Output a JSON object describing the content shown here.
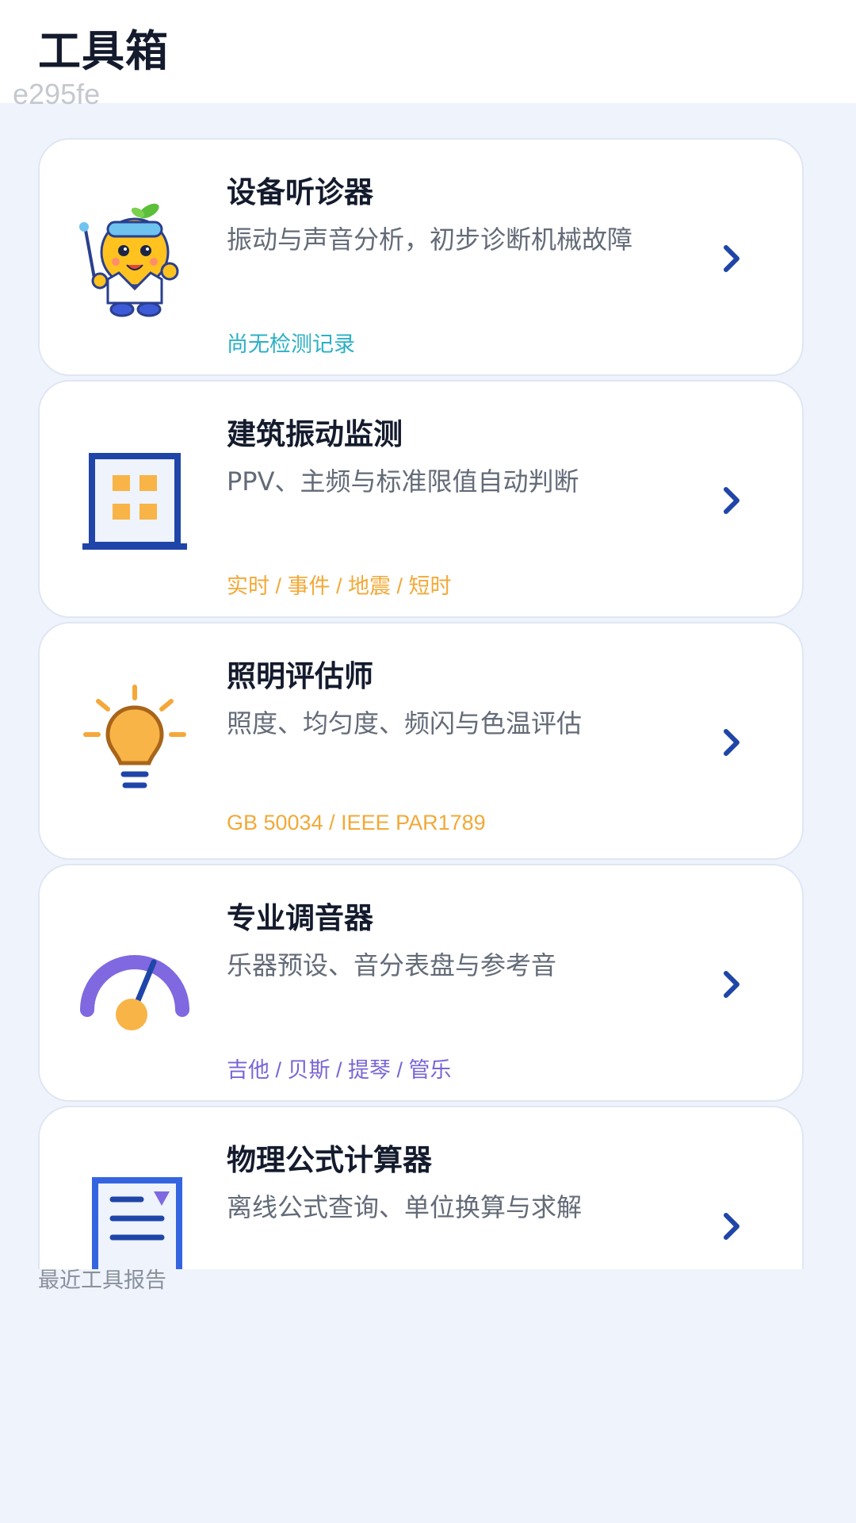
{
  "header": {
    "title": "工具箱",
    "hash_tag": "e295fe"
  },
  "tools": [
    {
      "title": "设备听诊器",
      "desc": "振动与声音分析，初步诊断机械故障",
      "tag": "尚无检测记录",
      "icon": "mascot-icon"
    },
    {
      "title": "建筑振动监测",
      "desc": "PPV、主频与标准限值自动判断",
      "tag": "实时 / 事件 / 地震 / 短时",
      "icon": "building-icon"
    },
    {
      "title": "照明评估师",
      "desc": "照度、均匀度、频闪与色温评估",
      "tag": "GB 50034 / IEEE PAR1789",
      "icon": "lightbulb-icon"
    },
    {
      "title": "专业调音器",
      "desc": "乐器预设、音分表盘与参考音",
      "tag": "吉他 / 贝斯 / 提琴 / 管乐",
      "icon": "gauge-icon"
    },
    {
      "title": "物理公式计算器",
      "desc": "离线公式查询、单位换算与求解",
      "tag": "",
      "icon": "formula-doc-icon"
    }
  ],
  "section_label": "最近工具报告",
  "colors": {
    "accent_blue": "#1f45a8",
    "tag_teal": "#2bb0c4",
    "tag_orange": "#f2a938",
    "tag_purple": "#7a65d6",
    "page_bg": "#eef3fc"
  }
}
